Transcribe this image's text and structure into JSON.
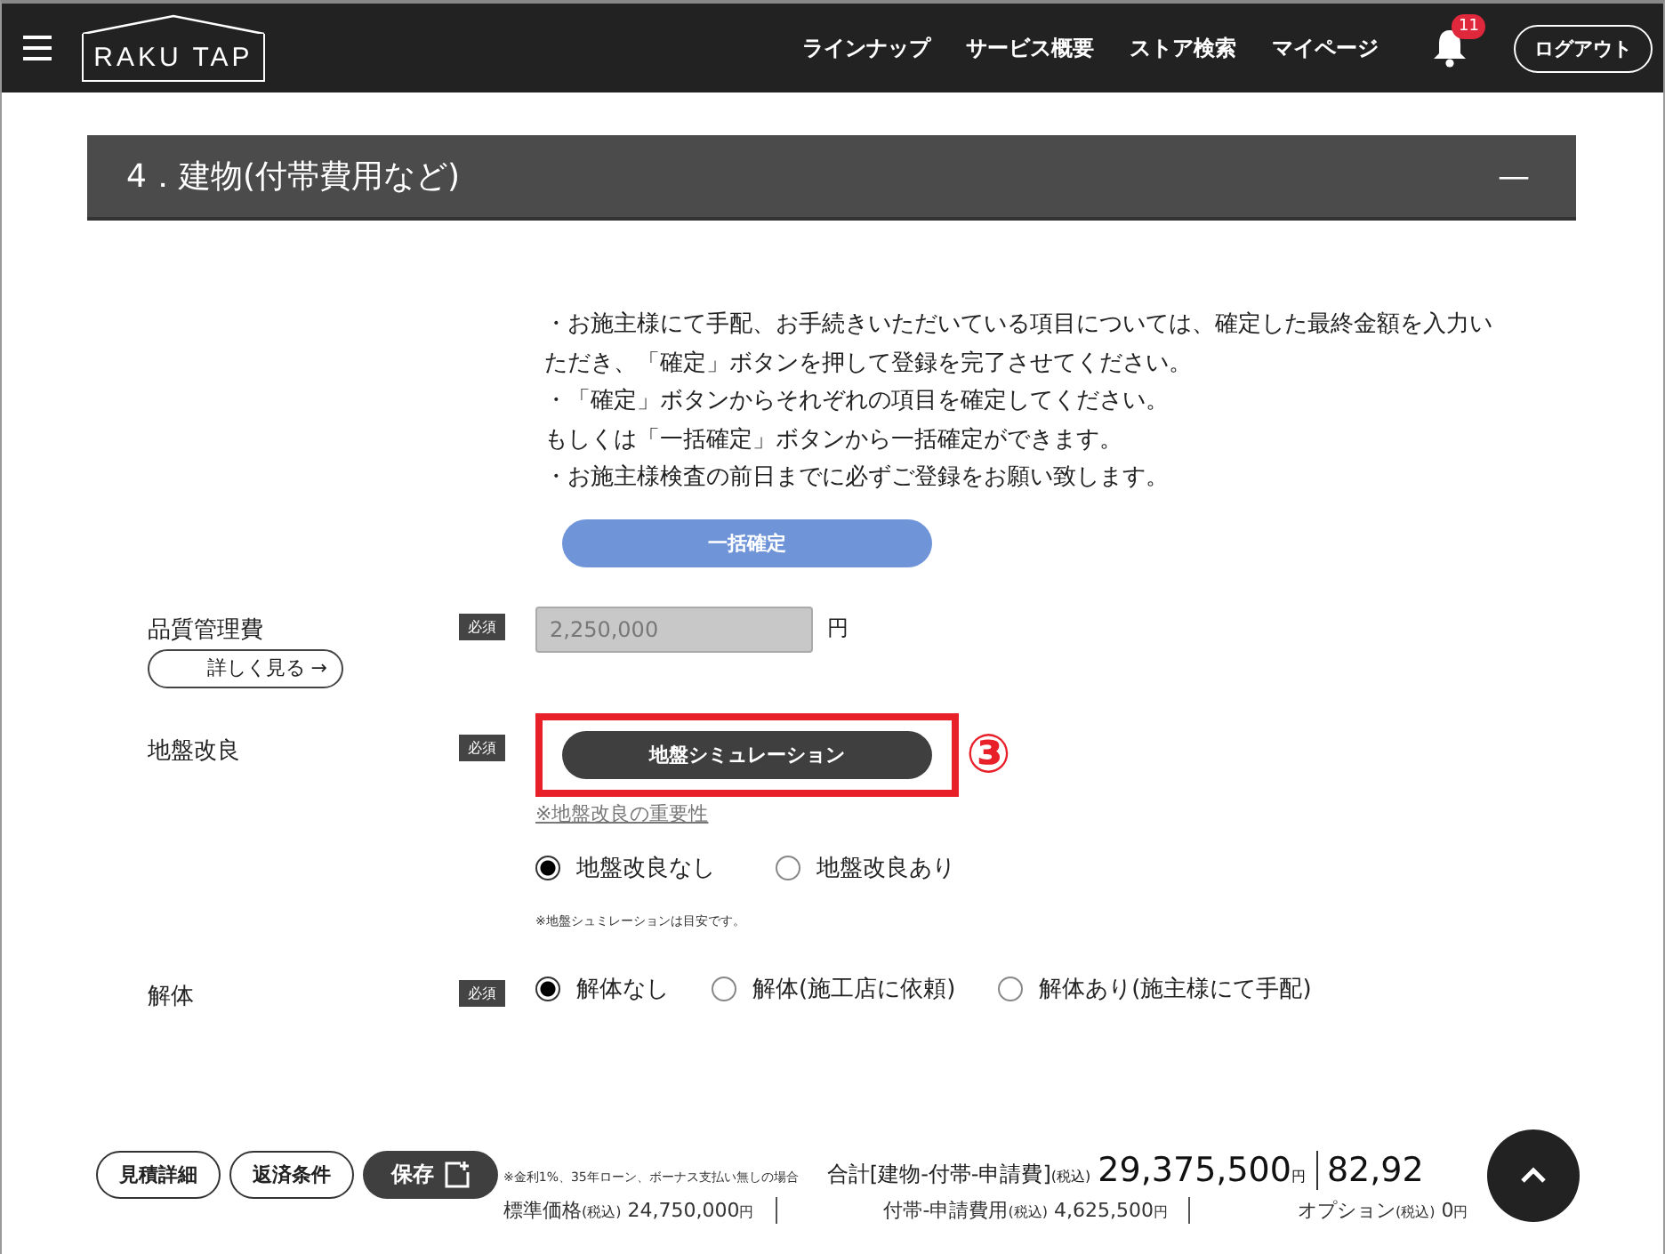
{
  "header": {
    "logo": "RAKU TAP",
    "nav": [
      "ラインナップ",
      "サービス概要",
      "ストア検索",
      "マイページ"
    ],
    "notification_count": "11",
    "logout": "ログアウト"
  },
  "section": {
    "title": "4．建物(付帯費用など)",
    "toggle": "—"
  },
  "notes": [
    "・お施主様にて手配、お手続きいただいている項目については、確定した最終金額を入力いただき、「確定」ボタンを押して登録を完了させてください。",
    "・「確定」ボタンからそれぞれの項目を確定してください。",
    "もしくは「一括確定」ボタンから一括確定ができます。",
    "・お施主様検査の前日までに必ずご登録をお願い致します。"
  ],
  "bulk_confirm": "一括確定",
  "rows": [
    {
      "kind": "amount",
      "label": "品質管理費",
      "required": "必須",
      "detail_link": "詳しく見る →",
      "value": "2,250,000",
      "unit": "円"
    },
    {
      "kind": "simulation",
      "label": "地盤改良",
      "required": "必須",
      "button": "地盤シミュレーション",
      "annotation": "③",
      "link": "※地盤改良の重要性",
      "options": [
        {
          "label": "地盤改良なし",
          "selected": true
        },
        {
          "label": "地盤改良あり",
          "selected": false
        }
      ],
      "note": "※地盤シュミレーションは目安です。"
    },
    {
      "kind": "radio",
      "label": "解体",
      "required": "必須",
      "options": [
        {
          "label": "解体なし",
          "selected": true
        },
        {
          "label": "解体(施工店に依頼)",
          "selected": false
        },
        {
          "label": "解体あり(施主様にて手配)",
          "selected": false
        }
      ]
    }
  ],
  "footer": {
    "buttons": [
      "見積詳細",
      "返済条件"
    ],
    "save": "保存",
    "loan_note": "※金利1%、35年ローン、ボーナス支払い無しの場合",
    "total_label": "合計[建物-付帯-申請費]",
    "tax": "(税込)",
    "total": "29,375,500",
    "yen": "円",
    "total2": "82,92",
    "breakdown": [
      {
        "label": "標準価格",
        "tax": "(税込)",
        "value": "24,750,000",
        "yen": "円"
      },
      {
        "label": "付帯-申請費用",
        "tax": "(税込)",
        "value": "4,625,500",
        "yen": "円"
      },
      {
        "label": "オプション",
        "tax": "(税込)",
        "value": "0",
        "yen": "円"
      }
    ]
  }
}
